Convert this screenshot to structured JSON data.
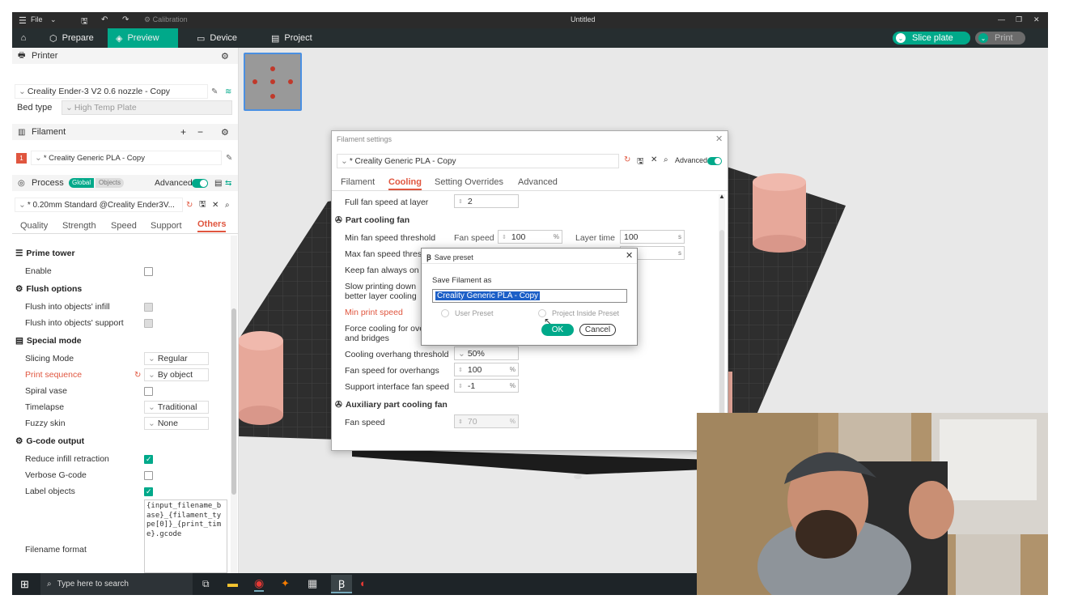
{
  "titlebar": {
    "file_label": "File",
    "calibration_label": "Calibration",
    "window_title": "Untitled"
  },
  "nav": {
    "tabs": [
      {
        "label": "Prepare"
      },
      {
        "label": "Preview"
      },
      {
        "label": "Device"
      },
      {
        "label": "Project"
      }
    ],
    "slice_label": "Slice plate",
    "print_label": "Print",
    "accent": "#00a98a"
  },
  "left": {
    "printer_header": "Printer",
    "printer_name": "Creality Ender-3 V2 0.6 nozzle - Copy",
    "bed_type_label": "Bed type",
    "bed_type_value": "High Temp Plate",
    "filament_header": "Filament",
    "filament_index": "1",
    "filament_name": "* Creality Generic PLA - Copy",
    "process_header": "Process",
    "global_label": "Global",
    "objects_label": "Objects",
    "advanced_label": "Advanced",
    "process_name": "* 0.20mm Standard @Creality Ender3V...",
    "subtabs": [
      "Quality",
      "Strength",
      "Speed",
      "Support",
      "Others"
    ],
    "prime_tower_header": "Prime tower",
    "enable_label": "Enable",
    "flush_header": "Flush options",
    "flush_infill_label": "Flush into objects' infill",
    "flush_support_label": "Flush into objects' support",
    "special_header": "Special mode",
    "slicing_mode_label": "Slicing Mode",
    "slicing_mode_value": "Regular",
    "print_sequence_label": "Print sequence",
    "print_sequence_value": "By object",
    "spiral_vase_label": "Spiral vase",
    "timelapse_label": "Timelapse",
    "timelapse_value": "Traditional",
    "fuzzy_skin_label": "Fuzzy skin",
    "fuzzy_skin_value": "None",
    "gcode_header": "G-code output",
    "reduce_infill_label": "Reduce infill retraction",
    "verbose_gcode_label": "Verbose G-code",
    "label_objects_label": "Label objects",
    "filename_format_label": "Filename format",
    "filename_format_value": "{input_filename_base}_{filament_type[0]}_{print_time}.gcode"
  },
  "filament_dialog": {
    "title": "Filament settings",
    "preset": "* Creality Generic PLA - Copy",
    "advanced_label": "Advanced",
    "tabs": [
      "Filament",
      "Cooling",
      "Setting Overrides",
      "Advanced"
    ],
    "full_fan_label": "Full fan speed at layer",
    "full_fan_value": "2",
    "part_cooling_header": "Part cooling fan",
    "min_fan_thresh_label": "Min fan speed threshold",
    "fan_speed_sub": "Fan speed",
    "min_fan_value": "100",
    "layer_time_sub": "Layer time",
    "layer_time_value": "100",
    "max_fan_thresh_label": "Max fan speed thresh",
    "keep_fan_label": "Keep fan always on",
    "slow_printing_label1": "Slow printing down",
    "slow_printing_label2": "better layer cooling",
    "min_print_speed_label": "Min print speed",
    "force_cooling_label1": "Force cooling for ove",
    "force_cooling_label2": "and bridges",
    "cooling_overhang_label": "Cooling overhang threshold",
    "cooling_overhang_value": "50%",
    "fan_overhang_label": "Fan speed for overhangs",
    "fan_overhang_value": "100",
    "support_interface_label": "Support interface fan speed",
    "support_interface_value": "-1",
    "aux_header": "Auxiliary part cooling fan",
    "aux_fan_label": "Fan speed",
    "aux_fan_value": "70",
    "pct": "%",
    "sec": "s"
  },
  "save_dialog": {
    "title": "Save preset",
    "prompt": "Save Filament as",
    "name_value": "Creality Generic PLA - Copy",
    "user_preset_label": "User Preset",
    "project_preset_label": "Project Inside Preset",
    "ok_label": "OK",
    "cancel_label": "Cancel"
  },
  "taskbar": {
    "search_placeholder": "Type here to search"
  }
}
